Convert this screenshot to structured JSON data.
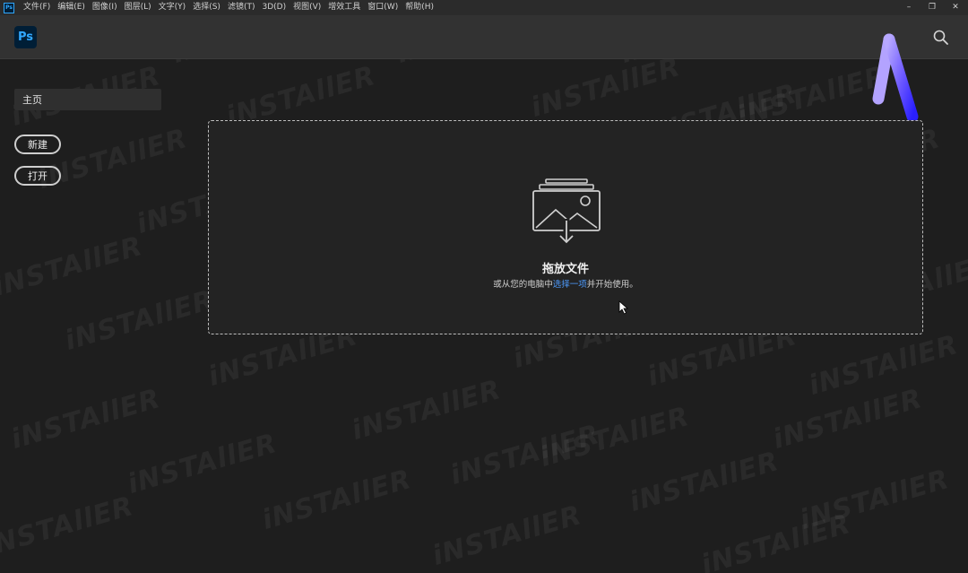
{
  "menubar": {
    "logo_text": "Ps",
    "items": [
      "文件(F)",
      "编辑(E)",
      "图像(I)",
      "图层(L)",
      "文字(Y)",
      "选择(S)",
      "滤镜(T)",
      "3D(D)",
      "视图(V)",
      "增效工具",
      "窗口(W)",
      "帮助(H)"
    ],
    "window_controls": {
      "minimize": "–",
      "restore": "❐",
      "close": "✕"
    }
  },
  "header": {
    "logo_text": "Ps",
    "search_icon": "search-icon"
  },
  "sidebar": {
    "home_label": "主页",
    "new_label": "新建",
    "open_label": "打开"
  },
  "dropzone": {
    "title": "拖放文件",
    "subtitle_before": "或从您的电脑中",
    "subtitle_link": "选择一项",
    "subtitle_after": "并开始使用。",
    "icon": "image-stack-download-icon"
  },
  "watermark": {
    "text": "iNSTAllER"
  },
  "colors": {
    "background": "#1e1e1e",
    "header": "#323232",
    "menubar": "#2b2b2b",
    "ps_blue": "#31a8ff",
    "ps_dark": "#001e36",
    "link": "#4e9cff",
    "brand_gradient_start": "#9b8cff",
    "brand_gradient_end": "#2a1fff"
  }
}
